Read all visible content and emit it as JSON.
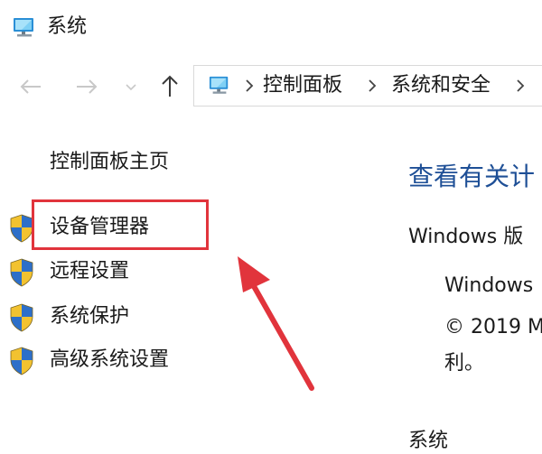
{
  "window": {
    "title": "系统",
    "icon": "computer-icon"
  },
  "nav": {
    "back_icon": "arrow-left-icon",
    "forward_icon": "arrow-right-icon",
    "recent_icon": "chevron-down-icon",
    "up_icon": "arrow-up-icon",
    "address_icon": "computer-icon",
    "breadcrumbs": [
      "控制面板",
      "系统和安全"
    ]
  },
  "left_pane": {
    "home_link": "控制面板主页",
    "tasks": [
      {
        "label": "设备管理器",
        "icon": "uac-shield-icon"
      },
      {
        "label": "远程设置",
        "icon": "uac-shield-icon"
      },
      {
        "label": "系统保护",
        "icon": "uac-shield-icon"
      },
      {
        "label": "高级系统设置",
        "icon": "uac-shield-icon"
      }
    ],
    "highlighted_task": "设备管理器"
  },
  "main": {
    "heading": "查看有关计",
    "windows_edition_label": "Windows 版",
    "windows_name": "Windows",
    "copyright_line1": "© 2019 M",
    "copyright_line2": "利。",
    "section_system": "系统"
  },
  "colors": {
    "heading": "#1e4f96",
    "highlight": "#e1343c",
    "arrow": "#e1343c"
  }
}
